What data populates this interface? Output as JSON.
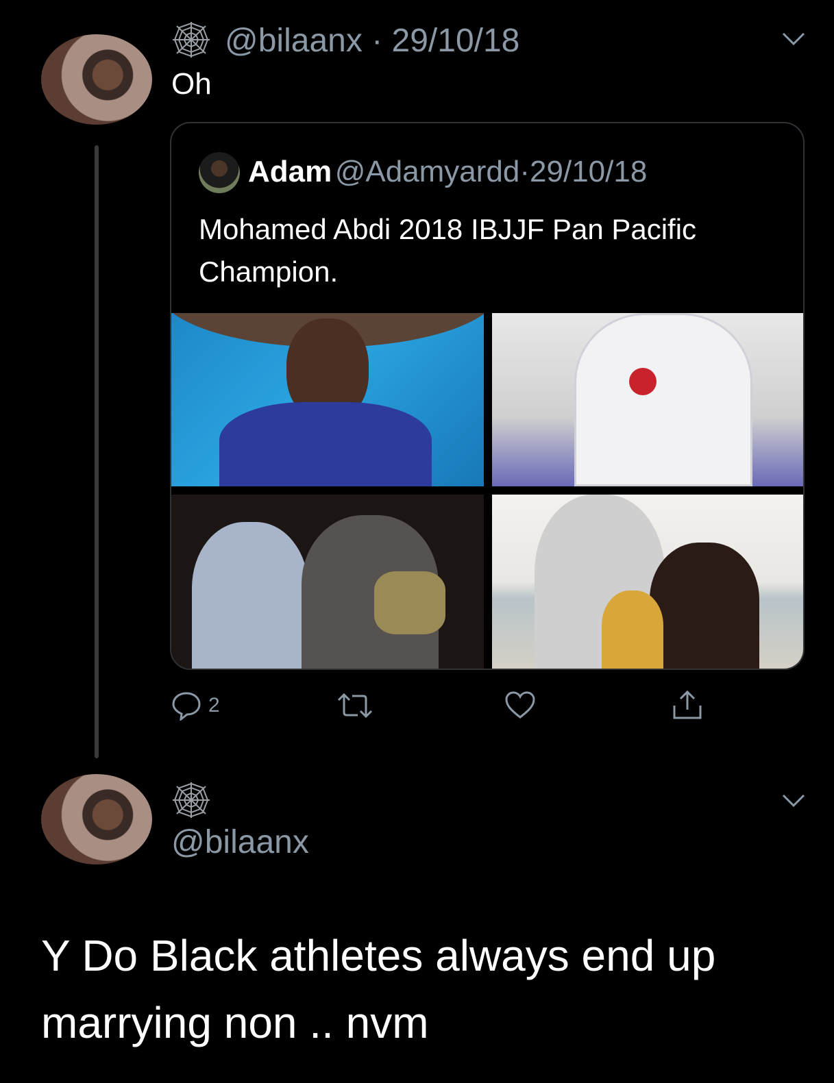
{
  "tweet1": {
    "handle": "@bilaanx",
    "separator": "·",
    "date": "29/10/18",
    "text": "Oh",
    "badge_icon": "spiderweb-icon",
    "menu_icon": "chevron-down-icon"
  },
  "quoted": {
    "name": "Adam",
    "handle": "@Adamyardd",
    "separator": "·",
    "date": "29/10/18",
    "text_line1": "Mohamed Abdi 2018 IBJJF Pan Pacific",
    "text_line2": "Champion.",
    "photos": [
      "photo-medal",
      "photo-training",
      "photo-belt",
      "photo-family"
    ]
  },
  "actions": {
    "reply_count": "2",
    "reply_icon": "reply-icon",
    "retweet_icon": "retweet-icon",
    "like_icon": "heart-icon",
    "share_icon": "share-icon"
  },
  "tweet2": {
    "handle": "@bilaanx",
    "badge_icon": "spiderweb-icon",
    "menu_icon": "chevron-down-icon",
    "text_line1": "Y Do Black athletes always end up",
    "text_line2": "marrying non .. nvm"
  },
  "colors": {
    "background": "#000000",
    "text": "#ffffff",
    "secondary": "#8b98a5",
    "border": "#2f3336"
  }
}
